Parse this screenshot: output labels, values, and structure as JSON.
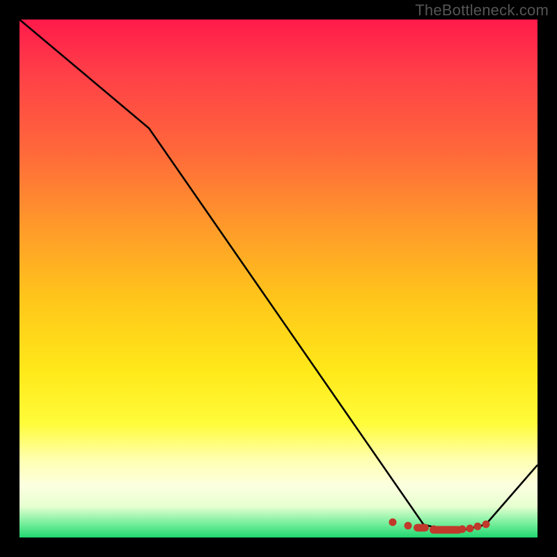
{
  "attribution": "TheBottleneck.com",
  "chart_data": {
    "type": "line",
    "title": "",
    "xlabel": "",
    "ylabel": "",
    "xlim": [
      0,
      100
    ],
    "ylim": [
      0,
      100
    ],
    "series": [
      {
        "name": "curve",
        "x": [
          0,
          25,
          78,
          82,
          86,
          90,
          100
        ],
        "values": [
          100,
          79,
          2.5,
          1.5,
          1.5,
          2.5,
          14
        ]
      }
    ],
    "markers": {
      "name": "optimal-zone",
      "x": [
        72,
        75,
        77.5,
        80,
        82,
        84,
        85.5,
        87,
        88.5,
        90
      ],
      "values": [
        3.0,
        2.3,
        1.9,
        1.6,
        1.5,
        1.5,
        1.6,
        1.8,
        2.1,
        2.5
      ]
    },
    "gradient_stops": [
      {
        "pos": 0,
        "color": "#ff1a4a"
      },
      {
        "pos": 26,
        "color": "#ff6a3a"
      },
      {
        "pos": 54,
        "color": "#ffc61a"
      },
      {
        "pos": 78,
        "color": "#fffc3a"
      },
      {
        "pos": 90,
        "color": "#fcffe0"
      },
      {
        "pos": 100,
        "color": "#20d870"
      }
    ]
  }
}
